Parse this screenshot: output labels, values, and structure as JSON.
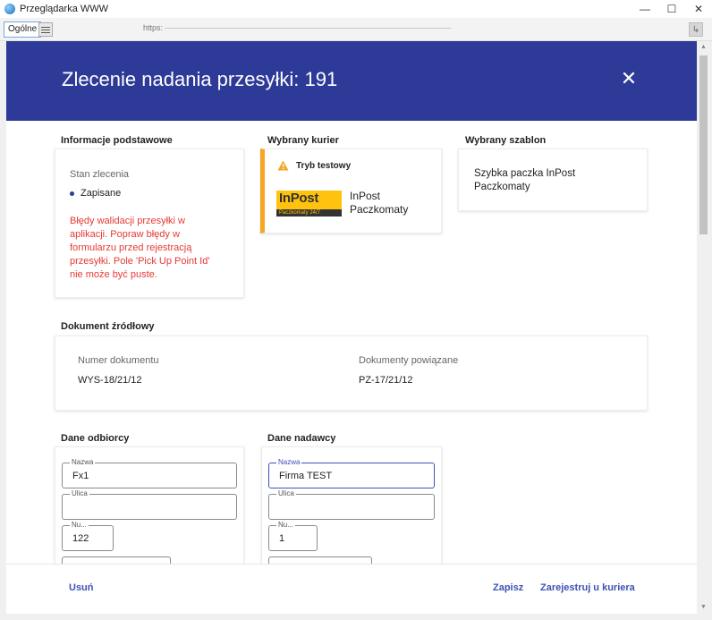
{
  "window": {
    "title": "Przeglądarka WWW",
    "minimize": "—",
    "maximize": "☐",
    "close": "✕"
  },
  "toolbar": {
    "tab_label": "Ogólne",
    "url_prefix": "https:",
    "right_button": "↳"
  },
  "header": {
    "title": "Zlecenie nadania przesyłki: 191",
    "close_icon": "✕"
  },
  "basic_info": {
    "section_title": "Informacje podstawowe",
    "status_label": "Stan zlecenia",
    "status_value": "Zapisane",
    "error_lines": [
      "Błędy walidacji przesyłki w",
      "aplikacji. Popraw błędy w",
      "formularzu przed rejestracją",
      "przesyłki. Pole 'Pick Up Point Id'",
      "nie może być puste."
    ]
  },
  "courier": {
    "section_title": "Wybrany kurier",
    "test_mode": "Tryb testowy",
    "logo_big": "InPost",
    "logo_small": "Paczkomaty 24/7",
    "name_line1": "InPost",
    "name_line2": "Paczkomaty",
    "accent_color": "#f5a623"
  },
  "template": {
    "section_title": "Wybrany szablon",
    "line1": "Szybka paczka InPost",
    "line2": "Paczkomaty"
  },
  "source_document": {
    "section_title": "Dokument źródłowy",
    "doc_number_label": "Numer dokumentu",
    "doc_number_value": "WYS-18/21/12",
    "related_label": "Dokumenty powiązane",
    "related_value": "PZ-17/21/12"
  },
  "recipient": {
    "section_title": "Dane odbiorcy",
    "name_label": "Nazwa",
    "name_value": "Fx1",
    "street_label": "Ulica",
    "street_value": "",
    "number_label": "Nu...",
    "number_value": "122"
  },
  "sender": {
    "section_title": "Dane nadawcy",
    "name_label": "Nazwa",
    "name_value": "Firma TEST",
    "street_label": "Ulica",
    "street_value": "",
    "number_label": "Nu...",
    "number_value": "1"
  },
  "footer": {
    "delete": "Usuń",
    "save": "Zapisz",
    "register": "Zarejestruj u kuriera"
  },
  "colors": {
    "header_bg": "#2d3a97",
    "link": "#3f51b5",
    "error": "#e53935"
  }
}
